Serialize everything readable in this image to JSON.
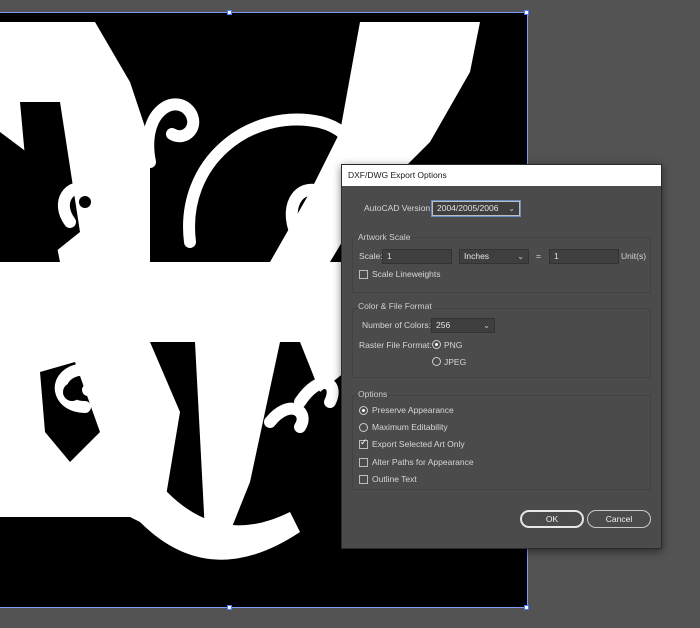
{
  "dialog": {
    "title": "DXF/DWG Export Options",
    "autocad_version_label": "AutoCAD Version:",
    "autocad_version_value": "2004/2005/2006",
    "artwork_scale": {
      "title": "Artwork Scale",
      "scale_label": "Scale:",
      "scale_value": "1",
      "unit_value": "Inches",
      "equals": "=",
      "units_value": "1",
      "units_label": "Unit(s)",
      "scale_lineweights_label": "Scale Lineweights",
      "scale_lineweights_checked": false
    },
    "color_file_format": {
      "title": "Color & File Format",
      "num_colors_label": "Number of Colors:",
      "num_colors_value": "256",
      "raster_format_label": "Raster File Format:",
      "png_label": "PNG",
      "jpeg_label": "JPEG",
      "selected_format": "PNG"
    },
    "options": {
      "title": "Options",
      "preserve_appearance_label": "Preserve Appearance",
      "maximum_editability_label": "Maximum Editability",
      "selected_mode": "Preserve Appearance",
      "export_selected_art_only_label": "Export Selected Art Only",
      "export_selected_art_only_checked": true,
      "alter_paths_label": "Alter Paths for Appearance",
      "alter_paths_checked": false,
      "outline_text_label": "Outline Text",
      "outline_text_checked": false
    },
    "ok_label": "OK",
    "cancel_label": "Cancel"
  },
  "colors": {
    "workspace": "#535353",
    "artboard": "#000000",
    "artwork": "#ffffff",
    "dialog_bg": "#4b4b4b",
    "selection": "#4d7bff"
  }
}
